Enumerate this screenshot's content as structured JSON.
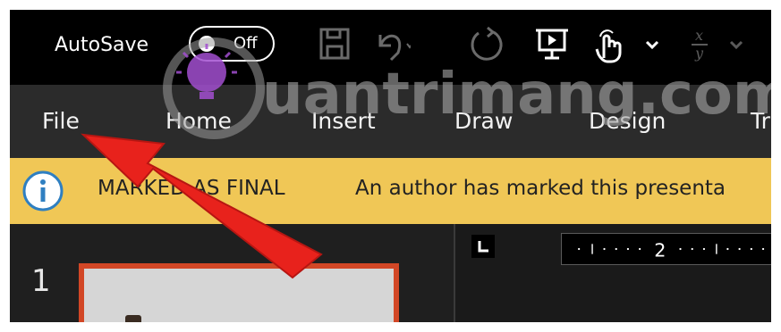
{
  "quick_access": {
    "autosave_label": "AutoSave",
    "autosave_state": "Off",
    "icons": [
      "save-icon",
      "undo-icon",
      "redo-icon",
      "present-icon",
      "touch-mode-icon",
      "customize-chevron-icon",
      "equation-icon"
    ]
  },
  "ribbon": {
    "tabs": [
      {
        "label": "File"
      },
      {
        "label": "Home"
      },
      {
        "label": "Insert"
      },
      {
        "label": "Draw"
      },
      {
        "label": "Design"
      },
      {
        "label": "Tra"
      }
    ]
  },
  "message_bar": {
    "title": "MARKED AS FINAL",
    "text": "An author has marked this presenta"
  },
  "thumbnails": {
    "slide_number": "1"
  },
  "ruler": {
    "label": "2"
  },
  "watermark": {
    "text": "uantrimang.com"
  },
  "colors": {
    "title_bar": "#000000",
    "ribbon": "#2b2b2b",
    "message_bar": "#f0c756",
    "slide_border": "#d24726",
    "arrow": "#e8221c"
  }
}
